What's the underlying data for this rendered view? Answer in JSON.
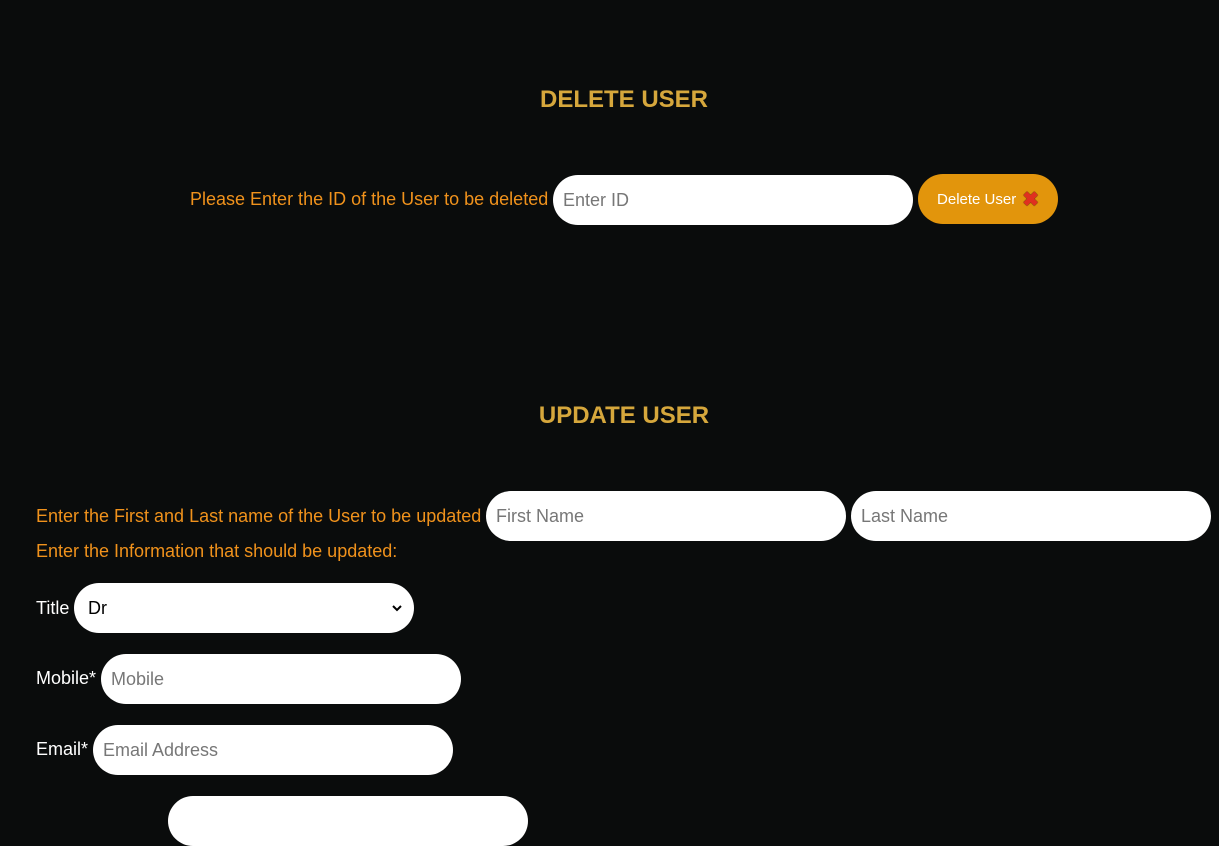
{
  "delete_section": {
    "title": "DELETE USER",
    "prompt": "Please Enter the ID of the User to be deleted",
    "id_placeholder": "Enter ID",
    "button_label": "Delete User",
    "button_icon": "✖"
  },
  "update_section": {
    "title": "UPDATE USER",
    "name_prompt": "Enter the First and Last name of the User to be updated",
    "first_name_placeholder": "First Name",
    "last_name_placeholder": "Last Name",
    "info_prompt": "Enter the Information that should be updated:",
    "title_label": "Title",
    "title_value": "Dr",
    "mobile_label": "Mobile*",
    "mobile_placeholder": "Mobile",
    "email_label": "Email*",
    "email_placeholder": "Email Address"
  }
}
